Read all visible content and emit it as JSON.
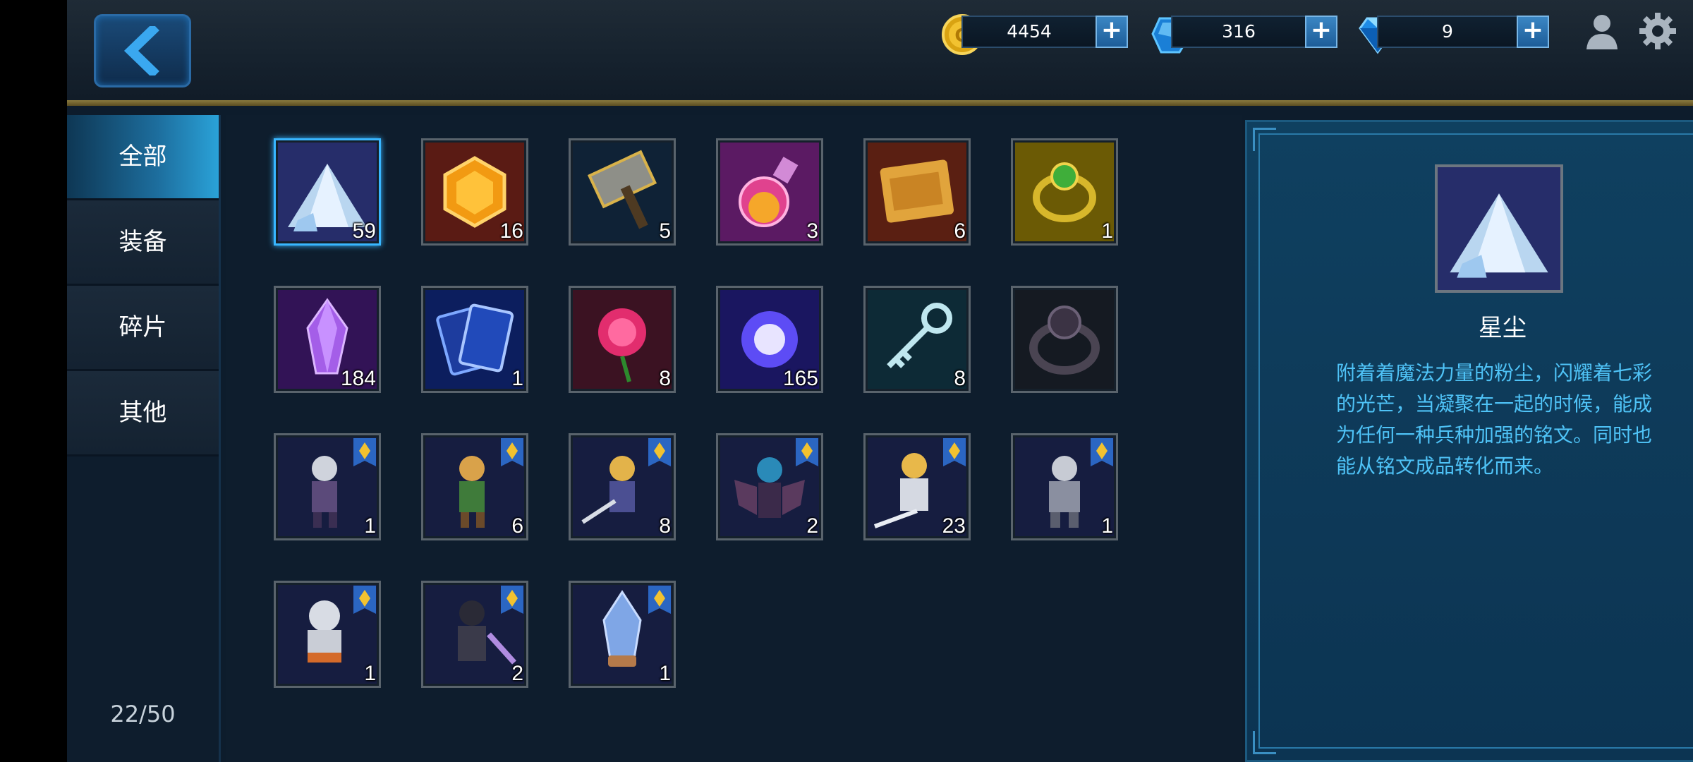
{
  "currency": {
    "gold": "4454",
    "gems": "316",
    "diamonds": "9"
  },
  "tabs": [
    {
      "label": "全部"
    },
    {
      "label": "装备"
    },
    {
      "label": "碎片"
    },
    {
      "label": "其他"
    }
  ],
  "inventory_count": "22/50",
  "items": [
    {
      "icon": "stardust-icon",
      "qty": "59"
    },
    {
      "icon": "orange-gem-icon",
      "qty": "16"
    },
    {
      "icon": "hammer-icon",
      "qty": "5"
    },
    {
      "icon": "potion-icon",
      "qty": "3"
    },
    {
      "icon": "scroll-icon",
      "qty": "6"
    },
    {
      "icon": "green-ring-icon",
      "qty": "1"
    },
    {
      "icon": "purple-crystal-icon",
      "qty": "184"
    },
    {
      "icon": "card-icon",
      "qty": "1"
    },
    {
      "icon": "rose-icon",
      "qty": "8"
    },
    {
      "icon": "magic-orb-icon",
      "qty": "165"
    },
    {
      "icon": "key-icon",
      "qty": "8"
    },
    {
      "icon": "dark-ring-icon",
      "qty": ""
    },
    {
      "icon": "hero-shard-icon",
      "qty": "1"
    },
    {
      "icon": "hero-shard-icon",
      "qty": "6"
    },
    {
      "icon": "hero-shard-icon",
      "qty": "8"
    },
    {
      "icon": "hero-shard-icon",
      "qty": "2"
    },
    {
      "icon": "hero-shard-icon",
      "qty": "23"
    },
    {
      "icon": "hero-shard-icon",
      "qty": "1"
    },
    {
      "icon": "hero-shard-icon",
      "qty": "1"
    },
    {
      "icon": "hero-shard-icon",
      "qty": "2"
    },
    {
      "icon": "crystal-shard-icon",
      "qty": "1"
    }
  ],
  "detail": {
    "name": "星尘",
    "description": "附着着魔法力量的粉尘，闪耀着七彩的光芒，当凝聚在一起的时候，能成为任何一种兵种加强的铭文。同时也能从铭文成品转化而来。"
  }
}
